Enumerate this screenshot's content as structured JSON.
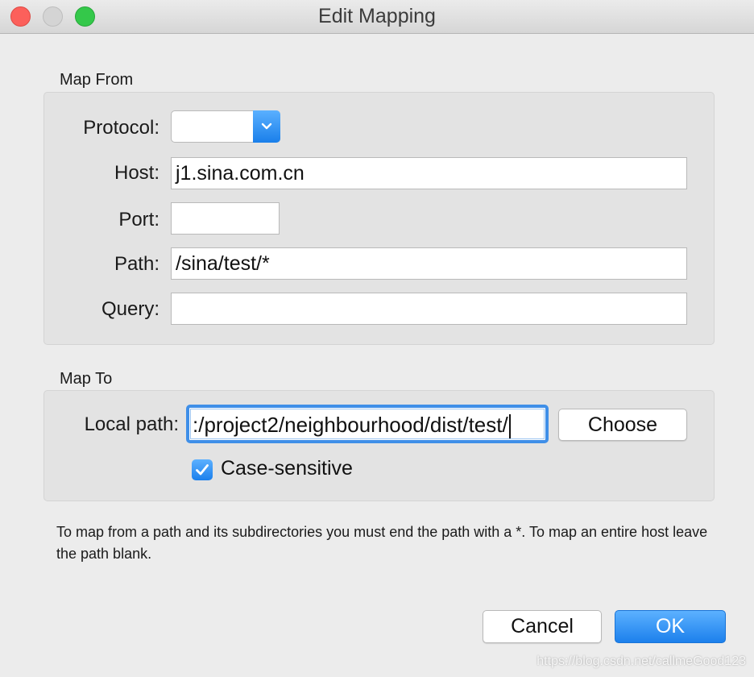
{
  "window": {
    "title": "Edit Mapping"
  },
  "map_from": {
    "section_label": "Map From",
    "protocol_label": "Protocol:",
    "protocol_value": "",
    "host_label": "Host:",
    "host_value": "j1.sina.com.cn",
    "port_label": "Port:",
    "port_value": "",
    "path_label": "Path:",
    "path_value": "/sina/test/*",
    "query_label": "Query:",
    "query_value": ""
  },
  "map_to": {
    "section_label": "Map To",
    "local_path_label": "Local path:",
    "local_path_value": ":/project2/neighbourhood/dist/test/",
    "choose_label": "Choose",
    "case_sensitive_label": "Case-sensitive",
    "case_sensitive_checked": true
  },
  "hint": "To map from a path and its subdirectories you must end the path with a *. To map an entire host leave the path blank.",
  "buttons": {
    "cancel_label": "Cancel",
    "ok_label": "OK"
  },
  "watermark": "https://blog.csdn.net/callmeGood123",
  "colors": {
    "accent": "#1c80ec",
    "window_bg": "#ececec",
    "group_bg": "#e3e3e3"
  },
  "icons": {
    "dropdown": "chevron-down-icon",
    "check": "checkmark-icon"
  }
}
